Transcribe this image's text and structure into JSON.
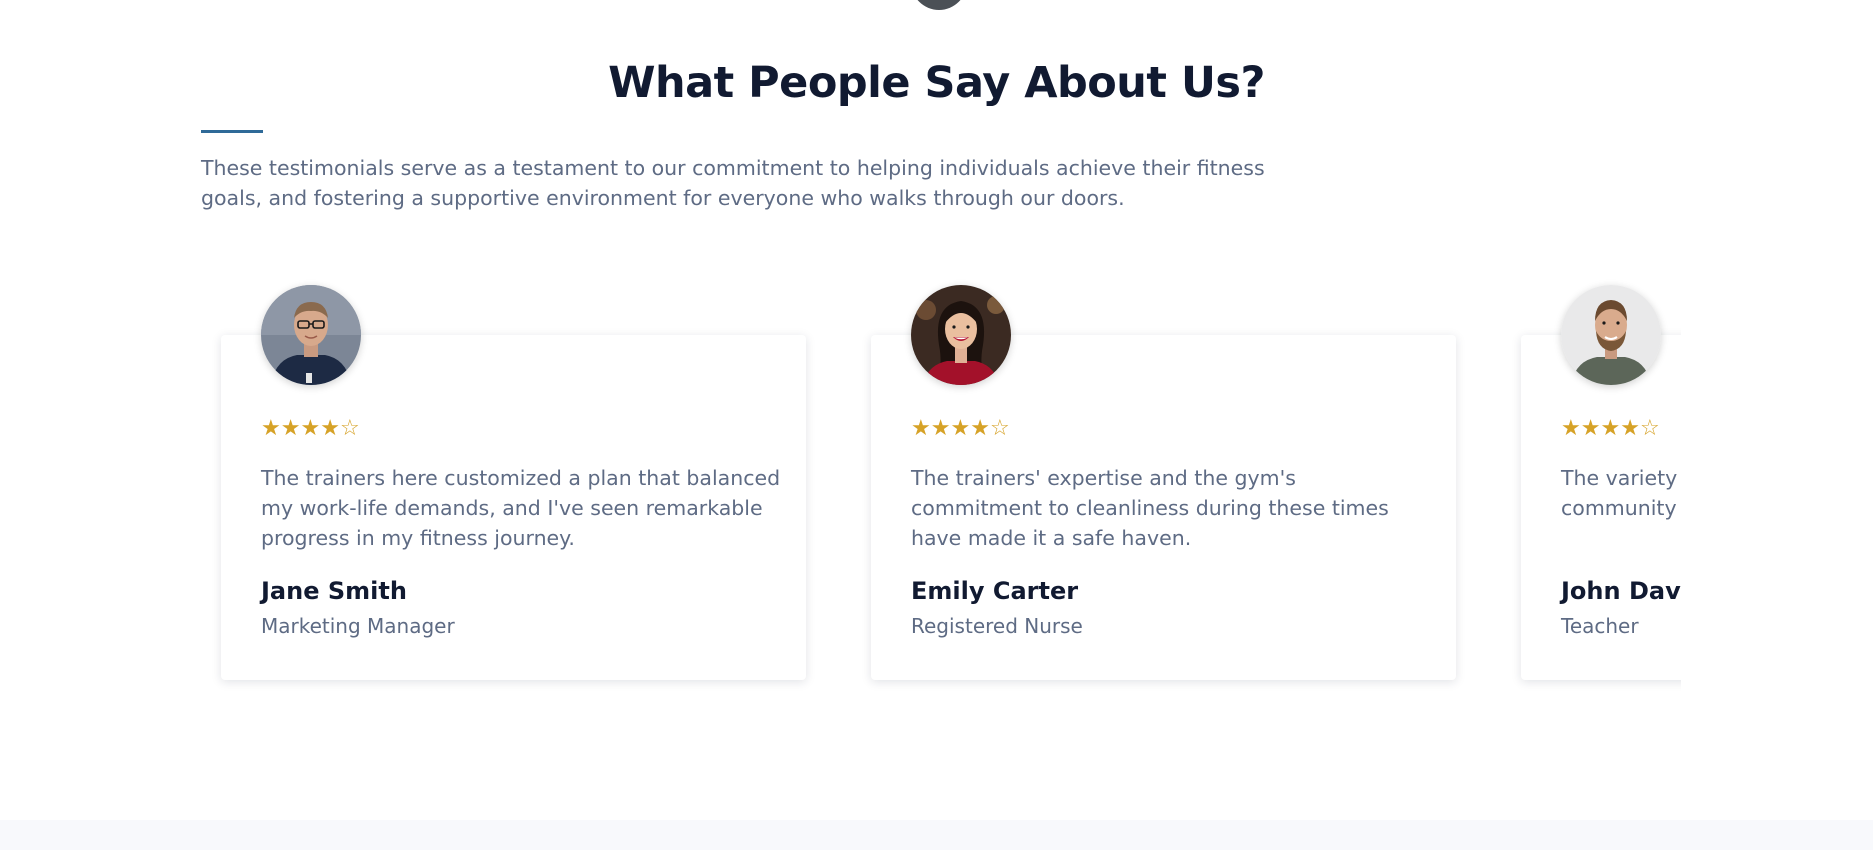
{
  "section": {
    "title": "What People Say About Us?",
    "intro": "These testimonials serve as a testament to our commitment to helping individuals achieve their fitness goals, and fostering a supportive environment for everyone who walks through our doors."
  },
  "colors": {
    "accent": "#2f6a98",
    "star": "#d6a227",
    "heading": "#111a31",
    "body": "#5e6b84"
  },
  "testimonials": [
    {
      "rating": 4,
      "max_rating": 5,
      "quote": "The trainers here customized a plan that balanced my work-life demands, and I've seen remarkable progress in my fitness journey.",
      "name": "Jane Smith",
      "role": "Marketing Manager",
      "avatar_icon": "person-portrait-icon"
    },
    {
      "rating": 4,
      "max_rating": 5,
      "quote": "The trainers' expertise and the gym's commitment to cleanliness during these times have made it a safe haven.",
      "name": "Emily Carter",
      "role": "Registered Nurse",
      "avatar_icon": "person-portrait-icon"
    },
    {
      "rating": 4,
      "max_rating": 5,
      "quote": "The variety of classes and the supportive community pounds and",
      "name": "John Davis",
      "role": "Teacher",
      "avatar_icon": "person-portrait-icon"
    }
  ]
}
